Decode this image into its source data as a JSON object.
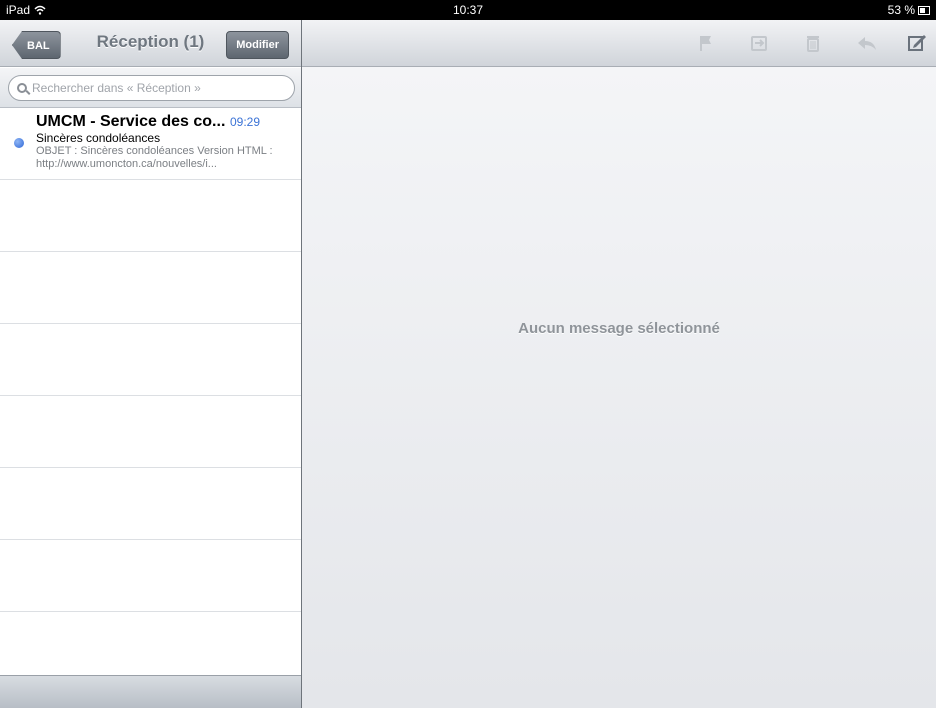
{
  "status_bar": {
    "device": "iPad",
    "wifi_icon": "wifi-icon",
    "time": "10:37",
    "battery": "53 %",
    "battery_icon": "battery-icon"
  },
  "mailbox": {
    "back_label": "BAL",
    "title": "Réception (1)",
    "edit_label": "Modifier",
    "search_placeholder": "Rechercher dans « Réception »",
    "messages": [
      {
        "sender": "UMCM - Service des co...",
        "time": "09:29",
        "subject": "Sincères condoléances",
        "preview": "OBJET : Sincères condoléances Version HTML : http://www.umoncton.ca/nouvelles/i...",
        "unread": true
      }
    ]
  },
  "detail": {
    "empty_text": "Aucun message sélectionné",
    "toolbar_icons": [
      "flag-icon",
      "move-folder-icon",
      "trash-icon",
      "reply-icon",
      "compose-icon"
    ]
  },
  "colors": {
    "accent": "#3b73d6",
    "unread_dot": "#2d66d6"
  }
}
